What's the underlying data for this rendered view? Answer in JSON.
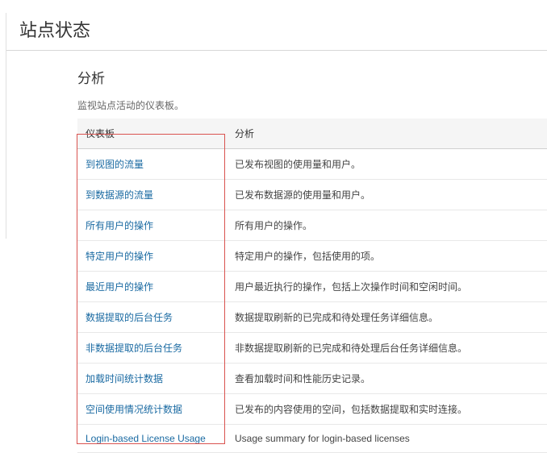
{
  "page": {
    "title": "站点状态"
  },
  "section": {
    "title": "分析",
    "description": "监视站点活动的仪表板。"
  },
  "table": {
    "headers": {
      "dashboard": "仪表板",
      "analysis": "分析"
    },
    "rows": [
      {
        "link": "到视图的流量",
        "desc": "已发布视图的使用量和用户。"
      },
      {
        "link": "到数据源的流量",
        "desc": "已发布数据源的使用量和用户。"
      },
      {
        "link": "所有用户的操作",
        "desc": "所有用户的操作。"
      },
      {
        "link": "特定用户的操作",
        "desc": "特定用户的操作，包括使用的项。"
      },
      {
        "link": "最近用户的操作",
        "desc": "用户最近执行的操作，包括上次操作时间和空闲时间。"
      },
      {
        "link": "数据提取的后台任务",
        "desc": "数据提取刷新的已完成和待处理任务详细信息。"
      },
      {
        "link": "非数据提取的后台任务",
        "desc": "非数据提取刷新的已完成和待处理后台任务详细信息。"
      },
      {
        "link": "加载时间统计数据",
        "desc": "查看加载时间和性能历史记录。"
      },
      {
        "link": "空间使用情况统计数据",
        "desc": "已发布的内容使用的空间，包括数据提取和实时连接。"
      },
      {
        "link": "Login-based License Usage",
        "desc": "Usage summary for login-based licenses"
      }
    ]
  }
}
